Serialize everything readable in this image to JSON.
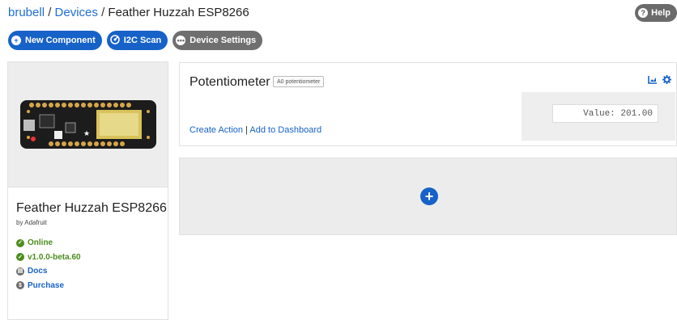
{
  "breadcrumb": {
    "user": "brubell",
    "separator": " / ",
    "section": "Devices",
    "current": "Feather Huzzah ESP8266"
  },
  "help": {
    "label": "Help",
    "icon": "question-icon"
  },
  "toolbar": {
    "new_component": "New Component",
    "i2c_scan": "I2C Scan",
    "device_settings": "Device Settings"
  },
  "device": {
    "name": "Feather Huzzah ESP8266",
    "by": "by Adafruit",
    "status": [
      {
        "label": "Online",
        "icon": "check-icon"
      },
      {
        "label": "v1.0.0-beta.60",
        "icon": "check-icon"
      },
      {
        "label": "Docs",
        "icon": "book-icon"
      },
      {
        "label": "Purchase",
        "icon": "dollar-icon"
      }
    ]
  },
  "component": {
    "title": "Potentiometer",
    "tag": "A0 potentiometer",
    "create_action": "Create Action",
    "divider": " | ",
    "add_dashboard": "Add to Dashboard",
    "value": "Value: 201.00"
  },
  "colors": {
    "accent": "#1762c8",
    "online": "#4a8d1c",
    "muted": "#6f6f6f"
  }
}
